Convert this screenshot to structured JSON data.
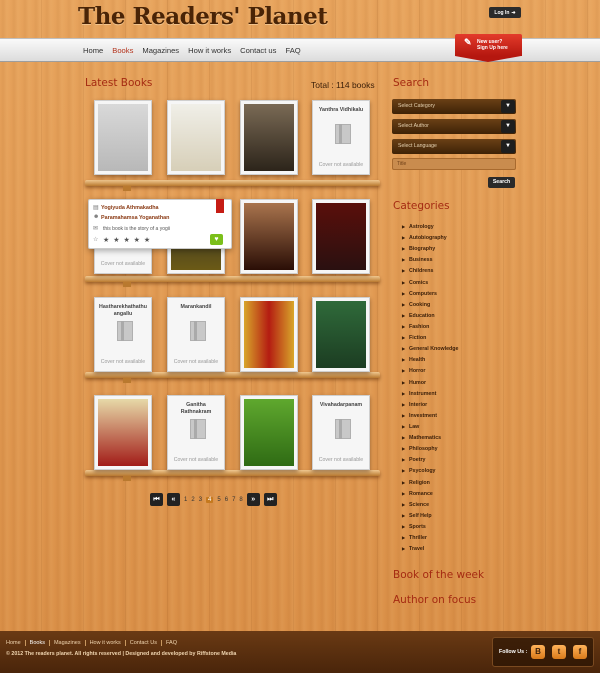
{
  "header": {
    "logo": "The Readers' Planet",
    "login_label": "Log In"
  },
  "nav": {
    "items": [
      "Home",
      "Books",
      "Magazines",
      "How it works",
      "Contact us",
      "FAQ"
    ],
    "active": "Books"
  },
  "signup": {
    "line1": "New user?",
    "line2": "Sign Up here"
  },
  "main": {
    "title": "Latest Books",
    "total": "Total : 114 books",
    "books": [
      {
        "title": "",
        "cover_available": true
      },
      {
        "title": "",
        "cover_available": true
      },
      {
        "title": "",
        "cover_available": true
      },
      {
        "title": "Yanthra Vidhikalu",
        "cover_available": false,
        "note": "Cover not available"
      },
      {
        "title": "",
        "cover_available": false,
        "note": "Cover not available"
      },
      {
        "title": "",
        "cover_available": true
      },
      {
        "title": "",
        "cover_available": true
      },
      {
        "title": "",
        "cover_available": true
      },
      {
        "title": "Hastharekhathathu angallu",
        "cover_available": false,
        "note": "Cover not available"
      },
      {
        "title": "Marankandil",
        "cover_available": false,
        "note": "Cover not available"
      },
      {
        "title": "",
        "cover_available": true
      },
      {
        "title": "",
        "cover_available": true
      },
      {
        "title": "",
        "cover_available": true
      },
      {
        "title": "Ganitha Rathnakram",
        "cover_available": false,
        "note": "Cover not available"
      },
      {
        "title": "",
        "cover_available": true
      },
      {
        "title": "Vivahadarpanam",
        "cover_available": false,
        "note": "Cover not available"
      }
    ],
    "tooltip": {
      "title": "Yogiyuda Athmakadha",
      "author": "Paramahamsa Yoganathan",
      "description": "this book is the story of a yogii",
      "stars": "★ ★ ★ ★ ★",
      "rating": 5
    },
    "pagination": {
      "pages": [
        "1",
        "2",
        "3",
        "4",
        "5",
        "6",
        "7",
        "8"
      ],
      "current": "4"
    }
  },
  "sidebar": {
    "search_title": "Search",
    "selects": [
      "Select Category",
      "Select Author",
      "Select Language"
    ],
    "title_placeholder": "Title",
    "search_button": "Search",
    "categories_title": "Categories",
    "categories": [
      "Astrology",
      "Autobiography",
      "Biography",
      "Business",
      "Childrens",
      "Comics",
      "Computers",
      "Cooking",
      "Education",
      "Fashion",
      "Fiction",
      "General Knowledge",
      "Health",
      "Horror",
      "Humor",
      "Instrument",
      "Interior",
      "Investment",
      "Law",
      "Mathematics",
      "Philosophy",
      "Poetry",
      "Psycology",
      "Religion",
      "Romance",
      "Science",
      "Self Help",
      "Sports",
      "Thriller",
      "Travel"
    ],
    "book_of_week": "Book of the week",
    "author_focus": "Author on focus"
  },
  "footer": {
    "links": [
      "Home",
      "Books",
      "Magazines",
      "How it works",
      "Contact Us",
      "FAQ"
    ],
    "active": "Books",
    "copyright": "© 2012 The readers planet. All rights reserved  |  Designed and developed by Riffstone Media",
    "follow_label": "Follow Us :",
    "social": [
      "blogger-icon",
      "twitter-icon",
      "facebook-icon"
    ]
  }
}
